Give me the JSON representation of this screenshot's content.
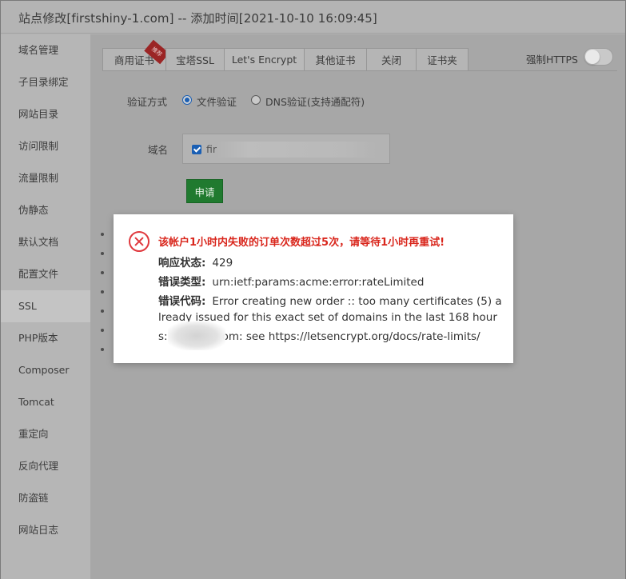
{
  "window": {
    "title": "站点修改[firstshiny-1.com] -- 添加时间[2021-10-10 16:09:45]"
  },
  "sidebar": {
    "items": [
      {
        "label": "域名管理"
      },
      {
        "label": "子目录绑定"
      },
      {
        "label": "网站目录"
      },
      {
        "label": "访问限制"
      },
      {
        "label": "流量限制"
      },
      {
        "label": "伪静态"
      },
      {
        "label": "默认文档"
      },
      {
        "label": "配置文件"
      },
      {
        "label": "SSL",
        "active": true
      },
      {
        "label": "PHP版本"
      },
      {
        "label": "Composer"
      },
      {
        "label": "Tomcat"
      },
      {
        "label": "重定向"
      },
      {
        "label": "反向代理"
      },
      {
        "label": "防盗链"
      },
      {
        "label": "网站日志"
      }
    ]
  },
  "tabs": [
    {
      "label": "商用证书",
      "badge": "推荐"
    },
    {
      "label": "宝塔SSL"
    },
    {
      "label": "Let's Encrypt",
      "active": true
    },
    {
      "label": "其他证书"
    },
    {
      "label": "关闭"
    },
    {
      "label": "证书夹"
    }
  ],
  "https_toggle": {
    "label": "强制HTTPS",
    "on": false
  },
  "form": {
    "verify_label": "验证方式",
    "options": [
      {
        "label": "文件验证",
        "checked": true
      },
      {
        "label": "DNS验证(支持通配符)",
        "checked": false
      }
    ],
    "domain_label": "域名",
    "domain_value": "fir",
    "apply_button": "申请"
  },
  "error_dialog": {
    "title": "该帐户1小时内失败的订单次数超过5次，请等待1小时再重试!",
    "status_label": "响应状态:",
    "status_value": "429",
    "type_label": "错误类型:",
    "type_value": "urn:ietf:params:acme:error:rateLimited",
    "code_label": "错误代码:",
    "code_line1": "Error creating new order :: too many certificates (5) a",
    "code_line2": "lready issued for this exact set of domains in the last 168 hour",
    "code_line3a": "s:",
    "code_line3b": "om: see https://letsencrypt.org/docs/rate-limits/"
  },
  "colors": {
    "error_red": "#d9261c",
    "apply_green": "#207a2f",
    "radio_blue": "#1a5fb4"
  }
}
